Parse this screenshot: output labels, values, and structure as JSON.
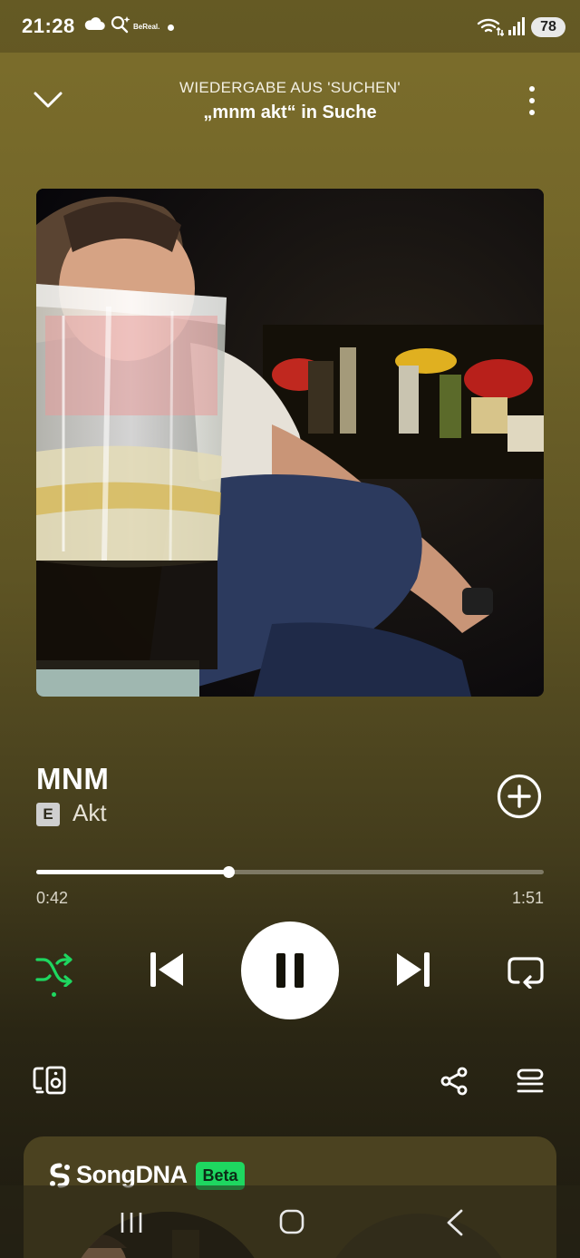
{
  "status_bar": {
    "time": "21:28",
    "bereal": "BeReal.",
    "battery": "78",
    "icons": [
      "cloud-icon",
      "search-sparkle-icon",
      "notification-dot",
      "wifi-icon",
      "signal-icon",
      "battery-icon"
    ]
  },
  "header": {
    "context": "WIEDERGABE AUS 'SUCHEN'",
    "source": "„mnm akt“ in Suche",
    "icons": [
      "chevron-down-icon",
      "more-vertical-icon"
    ]
  },
  "track": {
    "title": "MNM",
    "explicit_badge": "E",
    "artist": "Akt"
  },
  "progress": {
    "elapsed": "0:42",
    "total": "1:51",
    "fraction": 0.379
  },
  "controls": {
    "icons": [
      "shuffle-icon",
      "skip-previous-icon",
      "pause-icon",
      "skip-next-icon",
      "repeat-icon"
    ],
    "shuffle_active": true
  },
  "actions": {
    "icons": [
      "connect-device-icon",
      "share-icon",
      "queue-icon",
      "add-circle-icon"
    ]
  },
  "songdna": {
    "title": "SongDNA",
    "badge": "Beta"
  },
  "nav": {
    "icons": [
      "recent-apps-icon",
      "home-icon",
      "back-icon"
    ]
  },
  "colors": {
    "accent_green": "#1ed760",
    "background_top": "#7c6e2c",
    "background_bottom": "#1d1a10"
  }
}
